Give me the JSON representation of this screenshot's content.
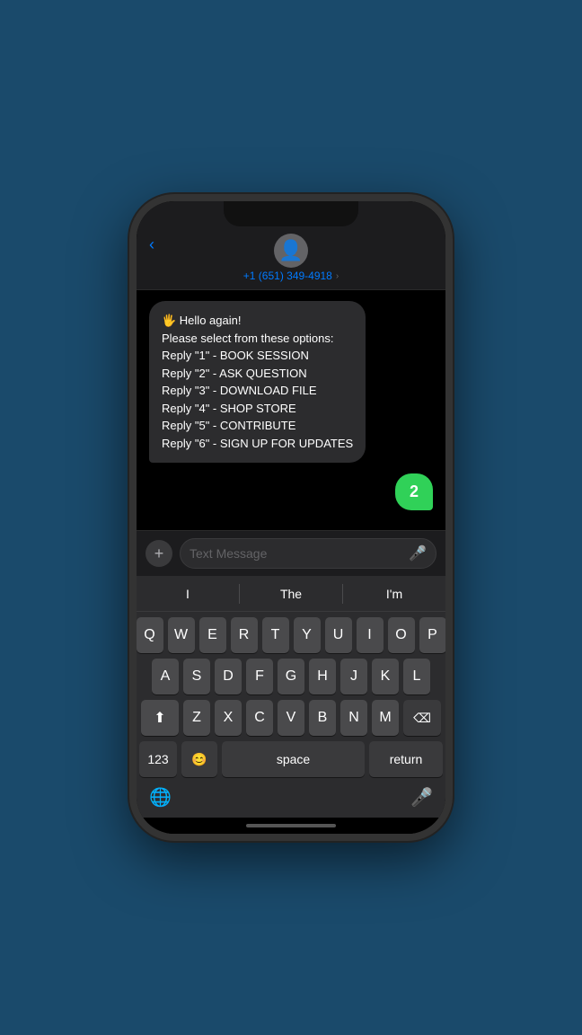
{
  "phone": {
    "header": {
      "back_label": "‹",
      "contact_number": "+1 (651) 349-4918",
      "chevron": "›"
    },
    "messages": [
      {
        "type": "received",
        "text": "🖐 Hello again!\nPlease select from these options:\nReply \"1\" - BOOK SESSION\nReply \"2\" - ASK QUESTION\nReply \"3\" - DOWNLOAD FILE\nReply \"4\" - SHOP STORE\nReply \"5\" - CONTRIBUTE\nReply \"6\" - SIGN UP FOR UPDATES"
      },
      {
        "type": "sent",
        "text": "2"
      }
    ],
    "input_bar": {
      "add_icon": "+",
      "placeholder": "Text Message",
      "mic_icon": "🎤"
    },
    "keyboard": {
      "predictive": [
        "I",
        "The",
        "I'm"
      ],
      "rows": [
        [
          "Q",
          "W",
          "E",
          "R",
          "T",
          "Y",
          "U",
          "I",
          "O",
          "P"
        ],
        [
          "A",
          "S",
          "D",
          "F",
          "G",
          "H",
          "J",
          "K",
          "L"
        ],
        [
          "⬆",
          "Z",
          "X",
          "C",
          "V",
          "B",
          "N",
          "M",
          "⌫"
        ],
        [
          "123",
          "😊",
          "space",
          "return"
        ]
      ],
      "bottom": {
        "globe": "🌐",
        "mic": "🎤"
      }
    }
  }
}
